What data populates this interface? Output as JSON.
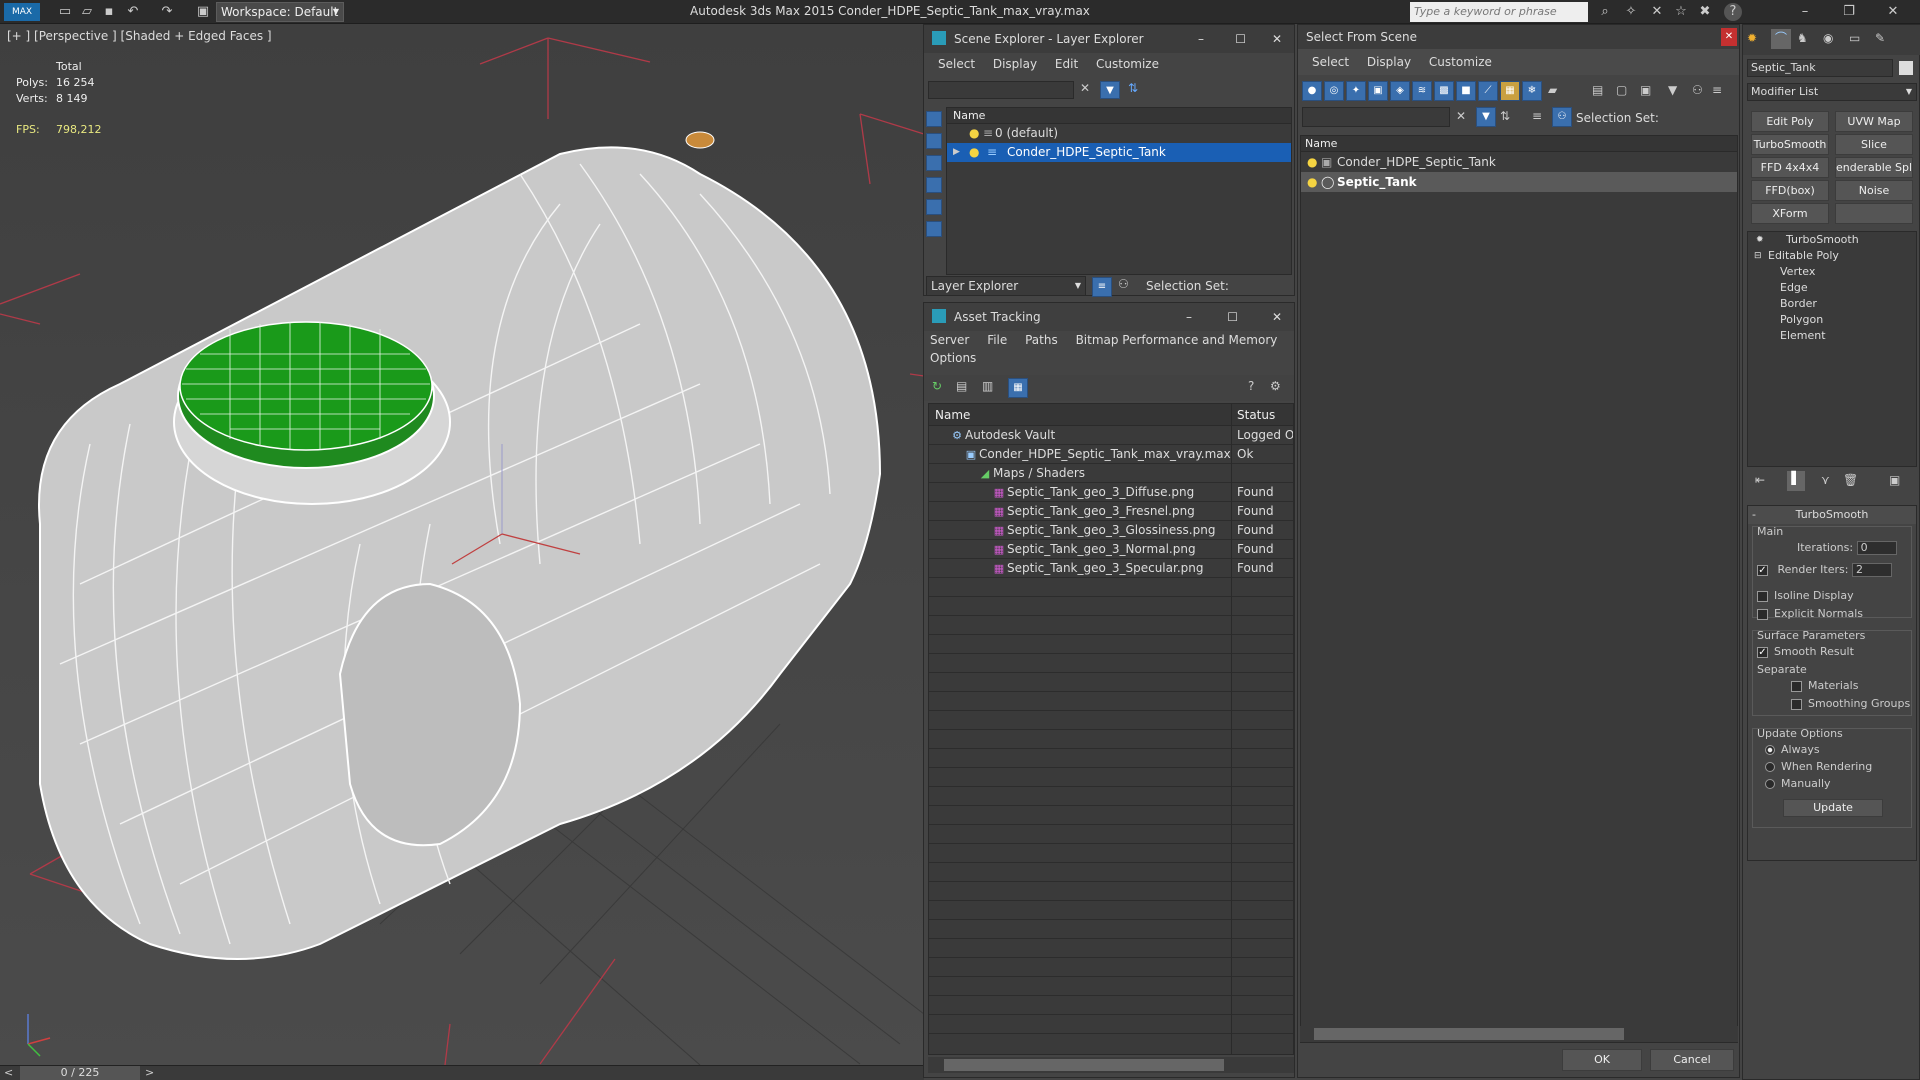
{
  "titlebar": {
    "workspace": "Workspace: Default",
    "app_title": "Autodesk 3ds Max  2015    Conder_HDPE_Septic_Tank_max_vray.max",
    "search_placeholder": "Type a keyword or phrase"
  },
  "viewport": {
    "label": "[+ ] [Perspective ] [Shaded + Edged Faces ]",
    "stats": {
      "total_label": "Total",
      "polys_label": "Polys:",
      "polys_value": "16 254",
      "verts_label": "Verts:",
      "verts_value": "8 149",
      "fps_label": "FPS:",
      "fps_value": "798,212"
    },
    "time_slider": "0 / 225"
  },
  "scene_explorer": {
    "title": "Scene Explorer - Layer Explorer",
    "menu": [
      "Select",
      "Display",
      "Edit",
      "Customize"
    ],
    "col_name": "Name",
    "rows": [
      "0 (default)",
      "Conder_HDPE_Septic_Tank"
    ],
    "footer_dropdown": "Layer Explorer",
    "selection_set": "Selection Set:"
  },
  "asset_tracking": {
    "title": "Asset Tracking",
    "menu1": [
      "Server",
      "File",
      "Paths",
      "Bitmap Performance and Memory"
    ],
    "menu2": [
      "Options"
    ],
    "col_name": "Name",
    "col_status": "Status",
    "rows": [
      {
        "name": "Autodesk Vault",
        "status": "Logged Ou",
        "indent": 0
      },
      {
        "name": "Conder_HDPE_Septic_Tank_max_vray.max",
        "status": "Ok",
        "indent": 1
      },
      {
        "name": "Maps / Shaders",
        "status": "",
        "indent": 2
      },
      {
        "name": "Septic_Tank_geo_3_Diffuse.png",
        "status": "Found",
        "indent": 3
      },
      {
        "name": "Septic_Tank_geo_3_Fresnel.png",
        "status": "Found",
        "indent": 3
      },
      {
        "name": "Septic_Tank_geo_3_Glossiness.png",
        "status": "Found",
        "indent": 3
      },
      {
        "name": "Septic_Tank_geo_3_Normal.png",
        "status": "Found",
        "indent": 3
      },
      {
        "name": "Septic_Tank_geo_3_Specular.png",
        "status": "Found",
        "indent": 3
      }
    ]
  },
  "select_from_scene": {
    "title": "Select From Scene",
    "menu": [
      "Select",
      "Display",
      "Customize"
    ],
    "selection_set": "Selection Set:",
    "col_name": "Name",
    "rows": [
      "Conder_HDPE_Septic_Tank",
      "Septic_Tank"
    ],
    "ok": "OK",
    "cancel": "Cancel"
  },
  "command_panel": {
    "object_name": "Septic_Tank",
    "modifier_list": "Modifier List",
    "mod_buttons": [
      "Edit Poly",
      "UVW Map",
      "TurboSmooth",
      "Slice",
      "FFD 4x4x4",
      "enderable Spli",
      "FFD(box)",
      "Noise",
      "XForm",
      ""
    ],
    "stack": {
      "turbosmooth": "TurboSmooth",
      "editable_poly": "Editable Poly",
      "subs": [
        "Vertex",
        "Edge",
        "Border",
        "Polygon",
        "Element"
      ]
    },
    "rollout": {
      "title": "TurboSmooth",
      "main": "Main",
      "iterations_label": "Iterations:",
      "iterations_value": "0",
      "render_iters_label": "Render Iters:",
      "render_iters_value": "2",
      "isoline": "Isoline Display",
      "explicit_normals": "Explicit Normals",
      "surface_params": "Surface Parameters",
      "smooth_result": "Smooth Result",
      "separate": "Separate",
      "materials": "Materials",
      "smoothing_groups": "Smoothing Groups",
      "update_options": "Update Options",
      "always": "Always",
      "when_rendering": "When Rendering",
      "manually": "Manually",
      "update": "Update"
    }
  },
  "colors": {
    "selection": "#1a5fb4",
    "lid_green": "#1f8a1f",
    "bg_dark": "#444444"
  }
}
